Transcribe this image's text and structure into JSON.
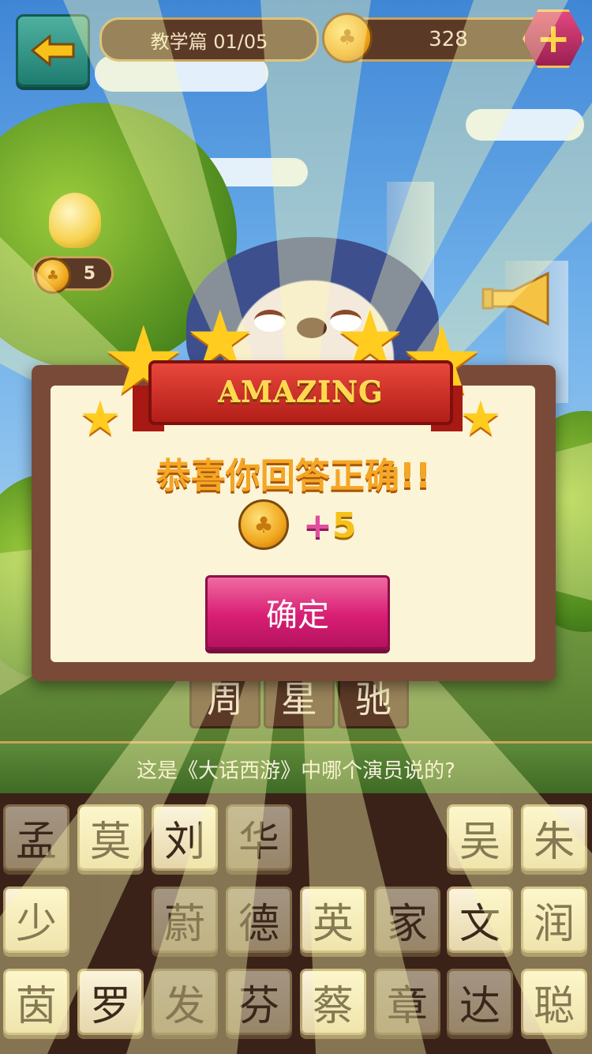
{
  "header": {
    "level_label": "教学篇 01/05",
    "coin_count": "328",
    "back_icon": "back-arrow-icon",
    "add_coins_icon": "plus-icon"
  },
  "tools": {
    "hint_cost": "5",
    "hint_icon": "lightbulb-icon",
    "share_icon": "megaphone-icon"
  },
  "answer_slots": [
    "周",
    "星",
    "驰"
  ],
  "question": "这是《大话西游》中哪个演员说的?",
  "grid": {
    "rows": [
      [
        "孟",
        "莫",
        "刘",
        "华",
        "",
        "",
        "吴",
        "朱"
      ],
      [
        "少",
        "",
        "蔚",
        "德",
        "英",
        "家",
        "文",
        "润"
      ],
      [
        "茵",
        "罗",
        "发",
        "芬",
        "蔡",
        "章",
        "达",
        "聪"
      ]
    ]
  },
  "dialog": {
    "banner": "AMAZING",
    "message": "恭喜你回答正确!!",
    "reward_plus": "+",
    "reward_amount": "5",
    "confirm_label": "确定"
  },
  "colors": {
    "accent_pink": "#d81e74",
    "banner_red": "#e9473c",
    "gold": "#ffcc1f",
    "panel_brown": "#7a4a38"
  }
}
